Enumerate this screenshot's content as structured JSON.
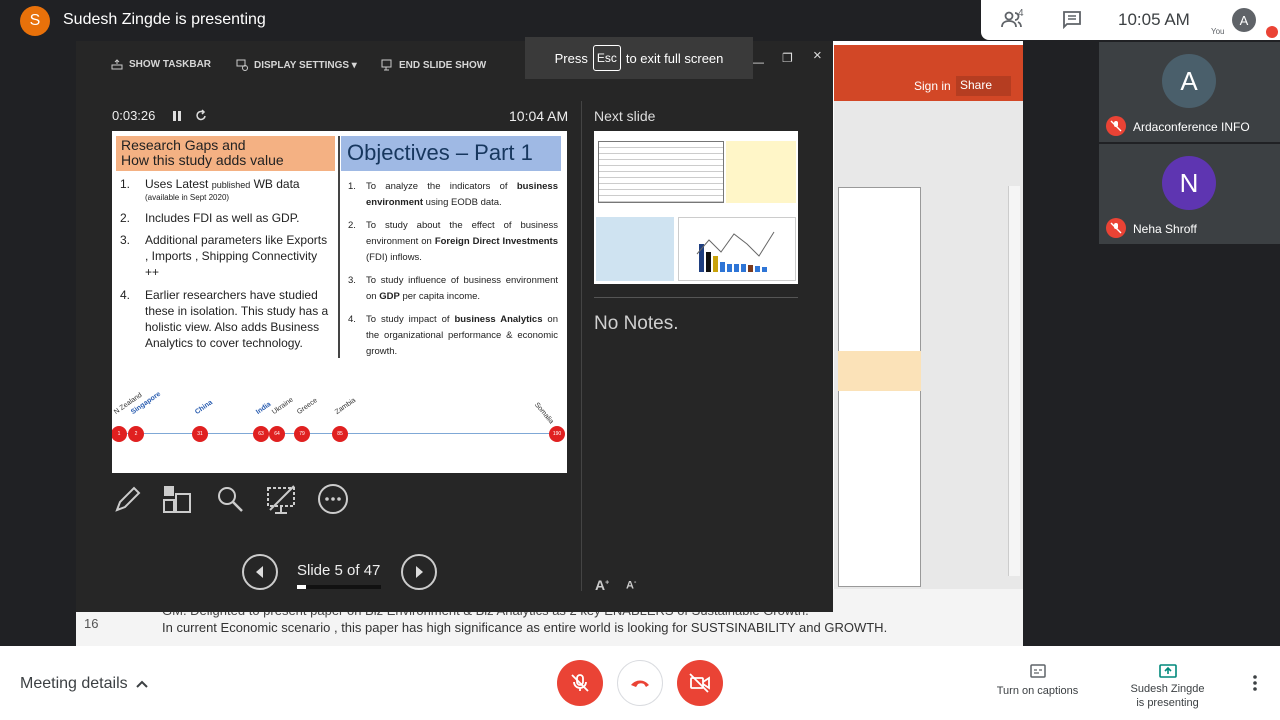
{
  "top": {
    "presenter_initial": "S",
    "presenter_title": "Sudesh Zingde is presenting",
    "people_count": "4",
    "clock": "10:05 AM",
    "you_initial": "A",
    "you_label": "You"
  },
  "participants": [
    {
      "initial": "A",
      "name": "Ardaconference INFO",
      "color": "#4a5f6b"
    },
    {
      "initial": "N",
      "name": "Neha Shroff",
      "color": "#5e35b1"
    }
  ],
  "powerpoint": {
    "sign_in": "Sign in",
    "share": "Share",
    "line_number": "16",
    "note_line_1": "GM. Delighted to present paper on Biz Environment & Biz Analytics as 2 key ENABLERS of Sustainable Growth.",
    "note_line_2": "In current Economic scenario , this paper has high significance as entire world is looking for SUSTSINABILITY and GROWTH."
  },
  "presenter_view": {
    "show_taskbar": "SHOW TASKBAR",
    "display_settings": "DISPLAY SETTINGS ▾",
    "end_slide_show": "END SLIDE SHOW",
    "esc_press": "Press",
    "esc_key": "Esc",
    "esc_rest": "to exit full screen",
    "timer": "0:03:26",
    "clock": "10:04 AM",
    "next_slide_label": "Next slide",
    "no_notes": "No Notes.",
    "slide_counter": "Slide 5 of 47",
    "progress": 0.106,
    "font_up": "A",
    "font_down": "A"
  },
  "slide": {
    "gaps_title_1": "Research Gaps and",
    "gaps_title_2": "How this study adds value",
    "objectives_title": "Objectives – Part 1",
    "gaps": [
      {
        "num": "1.",
        "text": "Uses Latest ",
        "small": "published",
        "text2": " WB data",
        "sub": "(available in Sept 2020)"
      },
      {
        "num": "2.",
        "text": "Includes FDI as well as GDP."
      },
      {
        "num": "3.",
        "text": "Additional parameters like Exports , Imports , Shipping Connectivity ++"
      },
      {
        "num": "4.",
        "text": "Earlier researchers have studied these in isolation. This study has a holistic view. Also adds Business Analytics to cover technology."
      }
    ],
    "objectives": [
      {
        "num": "1.",
        "a": "To analyze the indicators of ",
        "b": "business environment",
        "c": " using EODB data."
      },
      {
        "num": "2.",
        "a": "To study about the effect of business environment on ",
        "b": "Foreign Direct Investments",
        "c": " (FDI) inflows."
      },
      {
        "num": "3.",
        "a": "To study influence of business environment on ",
        "b": "GDP",
        "c": " per capita income."
      },
      {
        "num": "4.",
        "a": "To study impact of ",
        "b": "business Analytics",
        "c": " on the organizational performance & economic growth."
      }
    ],
    "timeline": [
      {
        "label": "N Zealand",
        "rank": "1",
        "hl": false
      },
      {
        "label": "Singapore",
        "rank": "2",
        "hl": true
      },
      {
        "label": "China",
        "rank": "31",
        "hl": true
      },
      {
        "label": "India",
        "rank": "63",
        "hl": true
      },
      {
        "label": "Ukraine",
        "rank": "64",
        "hl": false
      },
      {
        "label": "Greece",
        "rank": "79",
        "hl": false
      },
      {
        "label": "Zambia",
        "rank": "85",
        "hl": false
      },
      {
        "label": "Somalia",
        "rank": "190",
        "hl": false
      }
    ]
  },
  "bottom": {
    "meeting_details": "Meeting details",
    "captions": "Turn on captions",
    "presenting_1": "Sudesh Zingde",
    "presenting_2": "is presenting"
  }
}
